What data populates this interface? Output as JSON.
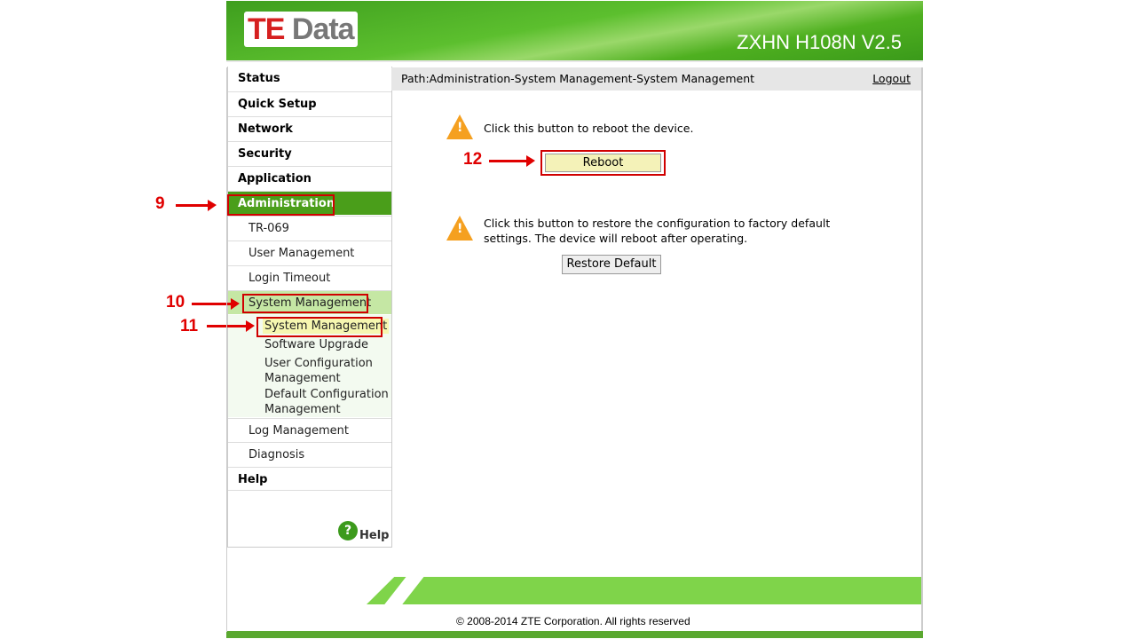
{
  "header": {
    "logo": "TE Data",
    "model": "ZXHN H108N V2.5"
  },
  "sidebar": {
    "items": [
      "Status",
      "Quick Setup",
      "Network",
      "Security",
      "Application",
      "Administration"
    ],
    "admin_items": [
      "TR-069",
      "User Management",
      "Login Timeout",
      "System Management"
    ],
    "sysmgmt_items": [
      "System Management",
      "Software Upgrade",
      "User Configuration Management",
      "Default Configuration Management"
    ],
    "after_items": [
      "Log Management",
      "Diagnosis"
    ],
    "help": "Help",
    "help_link": "Help"
  },
  "path": {
    "text": "Path:Administration-System Management-System Management",
    "logout": "Logout"
  },
  "main": {
    "reboot_text": "Click this button to reboot the device.",
    "reboot_button": "Reboot",
    "restore_text": "Click this button to restore the configuration to factory default settings. The device will reboot after operating.",
    "restore_button": "Restore Default"
  },
  "annotations": [
    "9",
    "10",
    "11",
    "12"
  ],
  "footer": {
    "copyright": "© 2008-2014 ZTE Corporation. All rights reserved"
  },
  "colors": {
    "active": "#4a9e1a",
    "selected": "#c5e7a4",
    "annotation": "#e00000",
    "footer_band": "#7fd44a"
  }
}
